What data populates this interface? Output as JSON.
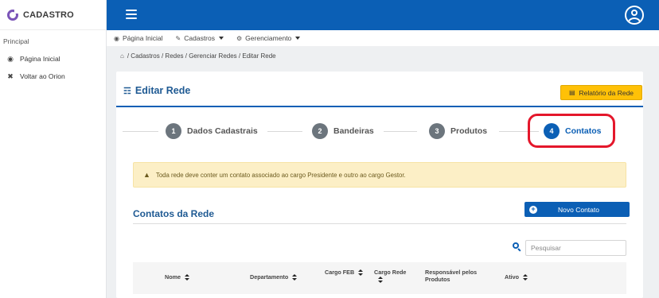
{
  "app": {
    "brand": "CADASTRO"
  },
  "sidebar": {
    "section": "Principal",
    "items": [
      {
        "label": "Página Inicial",
        "icon": "dashboard-icon"
      },
      {
        "label": "Voltar ao Orion",
        "icon": "close-icon"
      }
    ]
  },
  "menu": {
    "items": [
      {
        "label": "Página Inicial",
        "icon": "dashboard-icon"
      },
      {
        "label": "Cadastros",
        "icon": "edit-icon"
      },
      {
        "label": "Gerenciamento",
        "icon": "gear-icon"
      }
    ]
  },
  "breadcrumb": {
    "text": "/ Cadastros / Redes / Gerenciar Redes / Editar Rede"
  },
  "card": {
    "title": "Editar Rede",
    "report_button": "Relatório da Rede"
  },
  "steps": [
    {
      "number": "1",
      "label": "Dados Cadastrais"
    },
    {
      "number": "2",
      "label": "Bandeiras"
    },
    {
      "number": "3",
      "label": "Produtos"
    },
    {
      "number": "4",
      "label": "Contatos"
    }
  ],
  "alert": {
    "text": "Toda rede deve conter um contato associado ao cargo Presidente e outro ao cargo Gestor."
  },
  "contacts": {
    "title": "Contatos da Rede",
    "new_button": "Novo Contato",
    "search_placeholder": "Pesquisar"
  },
  "table": {
    "columns": [
      {
        "label": "Nome"
      },
      {
        "label": "Departamento"
      },
      {
        "label": "Cargo FEB"
      },
      {
        "label": "Cargo Rede"
      },
      {
        "label": "Responsável pelos Produtos"
      },
      {
        "label": "Ativo"
      }
    ]
  },
  "colors": {
    "primary": "#0b5fb5",
    "warning": "#ffc107",
    "highlight": "#e4172b"
  }
}
